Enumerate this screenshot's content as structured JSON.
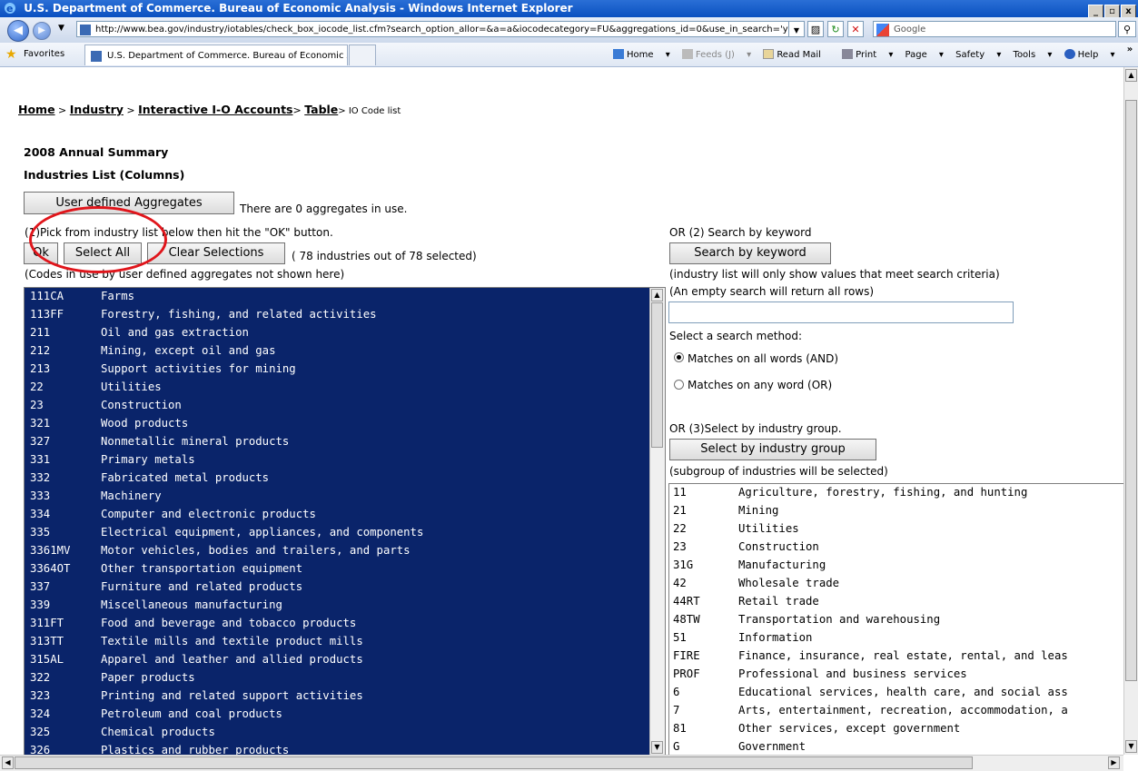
{
  "window": {
    "title": "U.S. Department of Commerce. Bureau of Economic Analysis - Windows Internet Explorer"
  },
  "address": {
    "url": "http://www.bea.gov/industry/iotables/check_box_iocode_list.cfm?search_option_allor=&a=a&iocodecategory=FU&aggregations_id=0&use_in_search='yes'&ro",
    "search_placeholder": "Google"
  },
  "favorites": {
    "label": "Favorites",
    "tab_title": "U.S. Department of Commerce. Bureau of Economic A..."
  },
  "commands": {
    "home": "Home",
    "feeds": "Feeds (J)",
    "read_mail": "Read Mail",
    "print": "Print",
    "page": "Page",
    "safety": "Safety",
    "tools": "Tools",
    "help": "Help"
  },
  "breadcrumb": {
    "home": "Home",
    "sep1": " > ",
    "industry": "Industry",
    "sep2": " > ",
    "io_accounts": "Interactive I-O Accounts",
    "sep3": "> ",
    "table": "Table",
    "current": "> IO Code list"
  },
  "heading": {
    "line1": "2008 Annual Summary",
    "line2": "Industries List (Columns)"
  },
  "aggregates": {
    "button": "User defined Aggregates",
    "note": "There are 0 aggregates in use."
  },
  "pick": {
    "instruction": "(1)Pick from industry list below then hit the \"OK\" button.",
    "ok": "Ok",
    "select_all": "Select All",
    "clear": "Clear Selections",
    "count": "( 78 industries out of 78 selected)",
    "codes_note": "(Codes in use by user defined aggregates not shown here)"
  },
  "industries": [
    {
      "code": "111CA",
      "name": "Farms"
    },
    {
      "code": "113FF",
      "name": "Forestry, fishing, and related activities"
    },
    {
      "code": "211",
      "name": "Oil and gas extraction"
    },
    {
      "code": "212",
      "name": "Mining, except oil and gas"
    },
    {
      "code": "213",
      "name": "Support activities for mining"
    },
    {
      "code": "22",
      "name": "Utilities"
    },
    {
      "code": "23",
      "name": "Construction"
    },
    {
      "code": "321",
      "name": "Wood products"
    },
    {
      "code": "327",
      "name": "Nonmetallic mineral products"
    },
    {
      "code": "331",
      "name": "Primary metals"
    },
    {
      "code": "332",
      "name": "Fabricated metal products"
    },
    {
      "code": "333",
      "name": "Machinery"
    },
    {
      "code": "334",
      "name": "Computer and electronic products"
    },
    {
      "code": "335",
      "name": "Electrical equipment, appliances, and components"
    },
    {
      "code": "3361MV",
      "name": "Motor vehicles, bodies and trailers, and parts"
    },
    {
      "code": "3364OT",
      "name": "Other transportation equipment"
    },
    {
      "code": "337",
      "name": "Furniture and related products"
    },
    {
      "code": "339",
      "name": "Miscellaneous manufacturing"
    },
    {
      "code": "311FT",
      "name": "Food and beverage and tobacco products"
    },
    {
      "code": "313TT",
      "name": "Textile mills and textile product mills"
    },
    {
      "code": "315AL",
      "name": "Apparel and leather and allied products"
    },
    {
      "code": "322",
      "name": "Paper products"
    },
    {
      "code": "323",
      "name": "Printing and related support activities"
    },
    {
      "code": "324",
      "name": "Petroleum and coal products"
    },
    {
      "code": "325",
      "name": "Chemical products"
    },
    {
      "code": "326",
      "name": "Plastics and rubber products"
    }
  ],
  "search": {
    "or_label": "OR (2) Search by keyword",
    "button": "Search by keyword",
    "note1": "(industry list will only show values that meet search criteria)",
    "note2": "(An empty search will return all rows)",
    "value": "",
    "method_label": "Select a search method:",
    "opt_and": "Matches on all words (AND)",
    "opt_or": "Matches on any word (OR)"
  },
  "group": {
    "or_label": "OR (3)Select by industry group.",
    "button": "Select by industry group",
    "note": "(subgroup of industries will be selected)"
  },
  "groups": [
    {
      "code": "11",
      "name": "Agriculture, forestry, fishing, and hunting"
    },
    {
      "code": "21",
      "name": "Mining"
    },
    {
      "code": "22",
      "name": "Utilities"
    },
    {
      "code": "23",
      "name": "Construction"
    },
    {
      "code": "31G",
      "name": "Manufacturing"
    },
    {
      "code": "42",
      "name": "Wholesale trade"
    },
    {
      "code": "44RT",
      "name": "Retail trade"
    },
    {
      "code": "48TW",
      "name": "Transportation and warehousing"
    },
    {
      "code": "51",
      "name": "Information"
    },
    {
      "code": "FIRE",
      "name": "Finance, insurance, real estate, rental, and leas"
    },
    {
      "code": "PROF",
      "name": "Professional and business services"
    },
    {
      "code": "6",
      "name": "Educational services, health care, and social ass"
    },
    {
      "code": "7",
      "name": "Arts, entertainment, recreation, accommodation, a"
    },
    {
      "code": "81",
      "name": "Other services, except government"
    },
    {
      "code": "G",
      "name": "Government"
    }
  ]
}
